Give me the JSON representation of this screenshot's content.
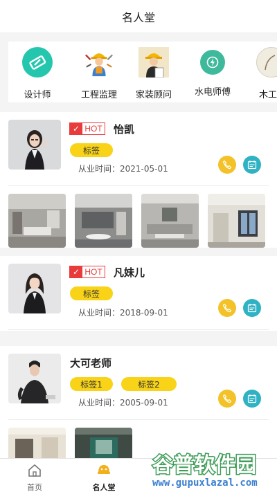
{
  "header": {
    "title": "名人堂"
  },
  "categories": [
    {
      "label": "设计师",
      "icon": "designer-icon"
    },
    {
      "label": "工程监理",
      "icon": "engineer-supervisor-icon"
    },
    {
      "label": "家装顾问",
      "icon": "home-consultant-icon"
    },
    {
      "label": "水电师傅",
      "icon": "plumber-electrician-icon"
    },
    {
      "label": "木工",
      "icon": "carpenter-icon"
    }
  ],
  "people": [
    {
      "name": "怡凯",
      "hot": "HOT",
      "tags": [
        "标签"
      ],
      "since": "从业时间：2021-05-01"
    },
    {
      "name": "凡妹儿",
      "hot": "HOT",
      "tags": [
        "标签"
      ],
      "since": "从业时间：2018-09-01"
    },
    {
      "name": "大可老师",
      "tags": [
        "标签1",
        "标签2"
      ],
      "since": "从业时间：2005-09-01"
    }
  ],
  "tabbar": {
    "home": "首页",
    "hall": "名人堂"
  },
  "watermark": {
    "title": "谷普软件园",
    "url": "www.gupuxlazal.com"
  },
  "colors": {
    "hot": "#e83b3b",
    "tag": "#f8d318",
    "call": "#f3c228",
    "calendar": "#2fb2c4",
    "active_tab": "#f1b01c"
  }
}
